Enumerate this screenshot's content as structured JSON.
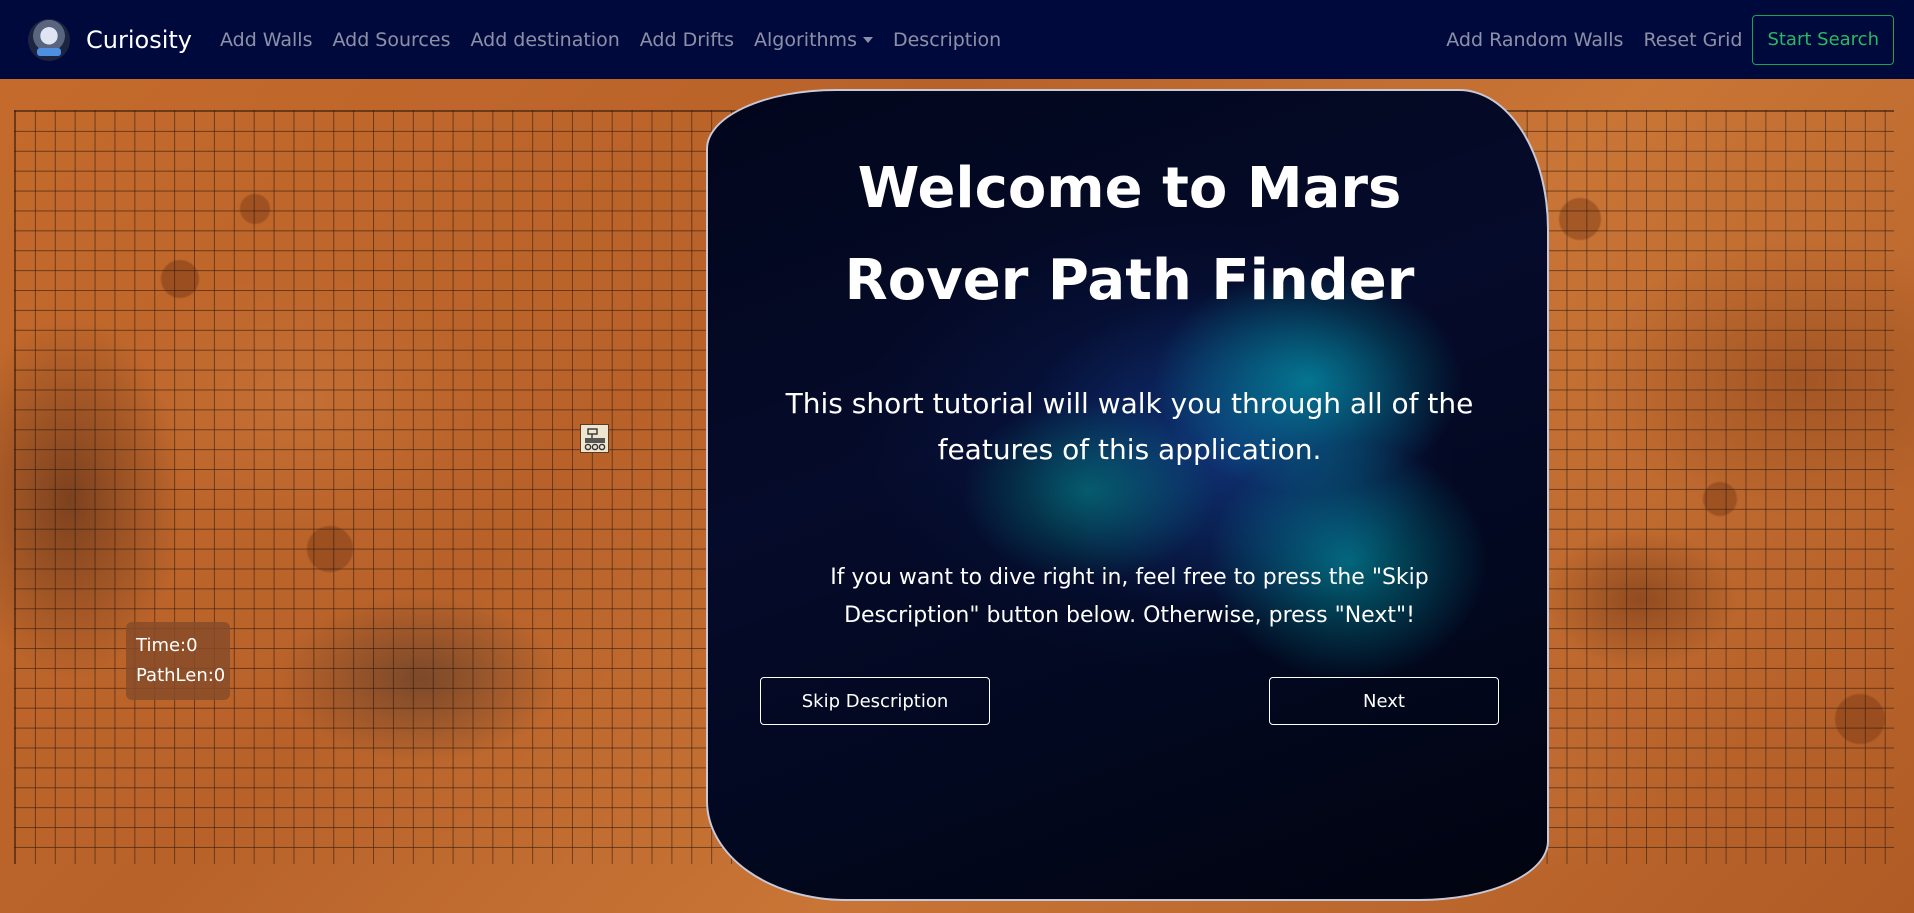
{
  "navbar": {
    "brand": "Curiosity",
    "links": [
      "Add Walls",
      "Add Sources",
      "Add destination",
      "Add Drifts"
    ],
    "algorithms_label": "Algorithms",
    "description_label": "Description",
    "random_walls_label": "Add Random Walls",
    "reset_label": "Reset Grid",
    "start_label": "Start Search",
    "start_color": "#29b864"
  },
  "stats": {
    "time": "Time:0",
    "path_len": "PathLen:0"
  },
  "modal": {
    "title": "Welcome to Mars Rover Path Finder",
    "subtitle": "This short tutorial will walk you through all of the features of this application.",
    "hint": "If you want to dive right in, feel free to press the \"Skip Description\" button below. Otherwise, press \"Next\"!",
    "skip_label": "Skip Description",
    "next_label": "Next"
  },
  "colors": {
    "navbar_bg": "#00093c",
    "mars_base": "#b8622a"
  },
  "icons": {
    "brand": "rover-logo-icon",
    "grid_source": "rover-icon"
  }
}
